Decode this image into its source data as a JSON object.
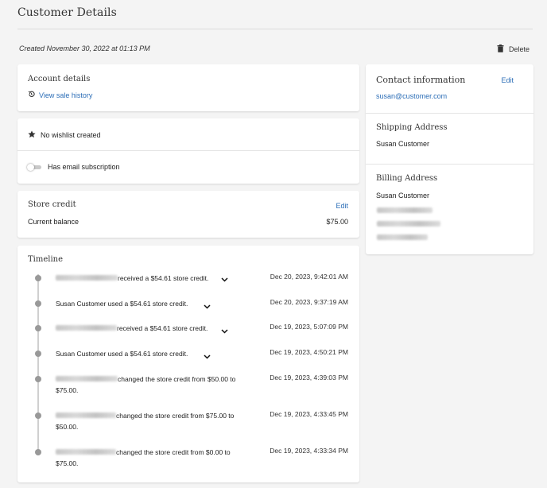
{
  "page": {
    "title": "Customer Details",
    "created": "Created November 30, 2022 at 01:13 PM",
    "delete_label": "Delete"
  },
  "account": {
    "heading": "Account details",
    "sale_history_link": "View sale history"
  },
  "wishlist": {
    "text": "No wishlist created",
    "email_subscription": "Has email subscription"
  },
  "store_credit": {
    "heading": "Store credit",
    "edit_label": "Edit",
    "balance_label": "Current balance",
    "balance_value": "$75.00"
  },
  "timeline": {
    "heading": "Timeline",
    "events": [
      {
        "text": "received a $54.61 store credit.",
        "date": "Dec 20, 2023, 9:42:01 AM"
      },
      {
        "text": "Susan Customer used a $54.61 store credit.",
        "date": "Dec 20, 2023, 9:37:19 AM"
      },
      {
        "text": "received a $54.61 store credit.",
        "date": "Dec 19, 2023, 5:07:09 PM"
      },
      {
        "text": "Susan Customer used a $54.61 store credit.",
        "date": "Dec 19, 2023, 4:50:21 PM"
      },
      {
        "text": "changed the store credit from $50.00 to",
        "text2": "$75.00.",
        "date": "Dec 19, 2023, 4:39:03 PM"
      },
      {
        "text": "changed the store credit from $75.00 to",
        "text2": "$50.00.",
        "date": "Dec 19, 2023, 4:33:45 PM"
      },
      {
        "text": "changed the store credit from $0.00 to",
        "text2": "$75.00.",
        "date": "Dec 19, 2023, 4:33:34 PM"
      }
    ]
  },
  "contact": {
    "heading": "Contact information",
    "edit_label": "Edit",
    "email": "susan@customer.com"
  },
  "shipping": {
    "heading": "Shipping Address",
    "name": "Susan Customer"
  },
  "billing": {
    "heading": "Billing Address",
    "name": "Susan Customer"
  },
  "colors": {
    "link": "#2c6eb7",
    "background": "#f4f4f4",
    "card": "#ffffff"
  }
}
